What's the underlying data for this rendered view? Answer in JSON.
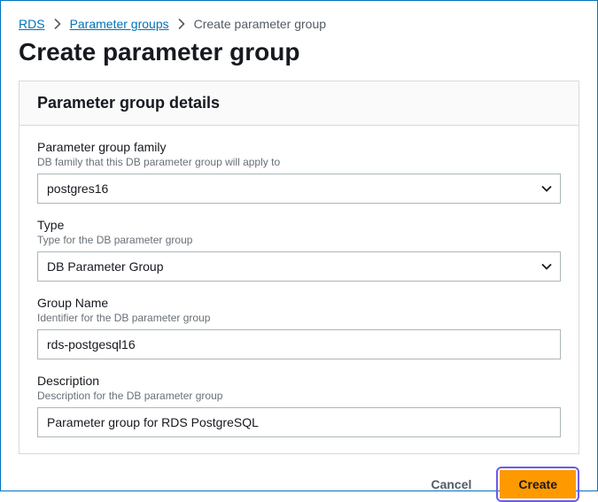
{
  "breadcrumb": {
    "items": [
      {
        "label": "RDS",
        "link": true
      },
      {
        "label": "Parameter groups",
        "link": true
      },
      {
        "label": "Create parameter group",
        "link": false
      }
    ]
  },
  "page": {
    "title": "Create parameter group"
  },
  "panel": {
    "title": "Parameter group details"
  },
  "fields": {
    "family": {
      "label": "Parameter group family",
      "hint": "DB family that this DB parameter group will apply to",
      "value": "postgres16"
    },
    "type": {
      "label": "Type",
      "hint": "Type for the DB parameter group",
      "value": "DB Parameter Group"
    },
    "groupName": {
      "label": "Group Name",
      "hint": "Identifier for the DB parameter group",
      "value": "rds-postgesql16"
    },
    "description": {
      "label": "Description",
      "hint": "Description for the DB parameter group",
      "value": "Parameter group for RDS PostgreSQL"
    }
  },
  "footer": {
    "cancel": "Cancel",
    "create": "Create"
  }
}
